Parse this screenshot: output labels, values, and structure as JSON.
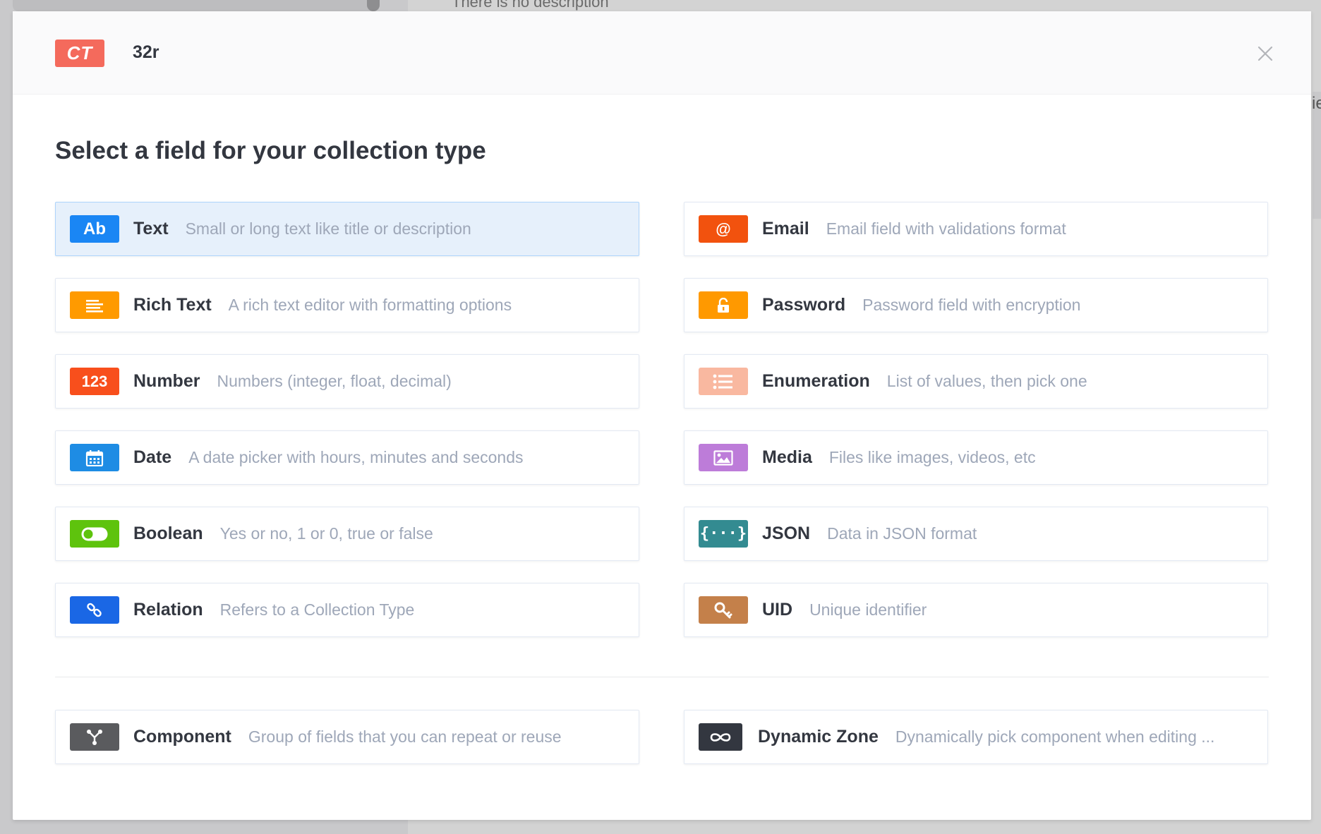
{
  "background": {
    "behind_text": "There is no description",
    "edge_char": "ie"
  },
  "header": {
    "badge": "CT",
    "title": "32r"
  },
  "title": "Select a field for your collection type",
  "fields": [
    {
      "label": "Text",
      "description": "Small or long text like title or description",
      "icon": "text-ab-icon",
      "color": "#1a86f4"
    },
    {
      "label": "Email",
      "description": "Email field with validations format",
      "icon": "at-icon",
      "color": "#f2520e"
    },
    {
      "label": "Rich Text",
      "description": "A rich text editor with formatting options",
      "icon": "align-left-icon",
      "color": "#ff9a00"
    },
    {
      "label": "Password",
      "description": "Password field with encryption",
      "icon": "lock-icon",
      "color": "#ff9900"
    },
    {
      "label": "Number",
      "description": "Numbers (integer, float, decimal)",
      "icon": "number-123-icon",
      "color": "#f84f1c"
    },
    {
      "label": "Enumeration",
      "description": "List of values, then pick one",
      "icon": "list-icon",
      "color": "#f9b8a0"
    },
    {
      "label": "Date",
      "description": "A date picker with hours, minutes and seconds",
      "icon": "calendar-icon",
      "color": "#1e8ce4"
    },
    {
      "label": "Media",
      "description": "Files like images, videos, etc",
      "icon": "image-icon",
      "color": "#bd7cd9"
    },
    {
      "label": "Boolean",
      "description": "Yes or no, 1 or 0, true or false",
      "icon": "toggle-icon",
      "color": "#5ec30d"
    },
    {
      "label": "JSON",
      "description": "Data in JSON format",
      "icon": "json-braces-icon",
      "color": "#338b91"
    },
    {
      "label": "Relation",
      "description": "Refers to a Collection Type",
      "icon": "link-icon",
      "color": "#1a67e5"
    },
    {
      "label": "UID",
      "description": "Unique identifier",
      "icon": "key-icon",
      "color": "#c4804a"
    }
  ],
  "special_fields": [
    {
      "label": "Component",
      "description": "Group of fields that you can repeat or reuse",
      "icon": "component-icon",
      "color": "#5a5b5e"
    },
    {
      "label": "Dynamic Zone",
      "description": "Dynamically pick component when editing ...",
      "icon": "infinity-icon",
      "color": "#333740"
    }
  ],
  "selected_field": "Text"
}
